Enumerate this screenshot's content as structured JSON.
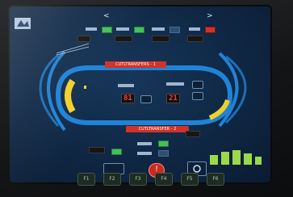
{
  "screen": {
    "title": "",
    "title_left_arrow": "<",
    "title_right_arrow": ">"
  },
  "track": {
    "top_bar_label": "CUTLTRANSFERS - 1",
    "bottom_bar_label": "CUTLTRANSFER - 2"
  },
  "displays": {
    "big_left": "81",
    "big_right": "21"
  },
  "function_keys": [
    "F1",
    "F2",
    "F3",
    "F4",
    "F5",
    "F6"
  ],
  "colors": {
    "screen_bg": "#0f2744",
    "track_blue": "#1f83d6",
    "track_yellow": "#f2d02a",
    "alarm_red": "#d23228",
    "ok_green": "#42c25a"
  }
}
